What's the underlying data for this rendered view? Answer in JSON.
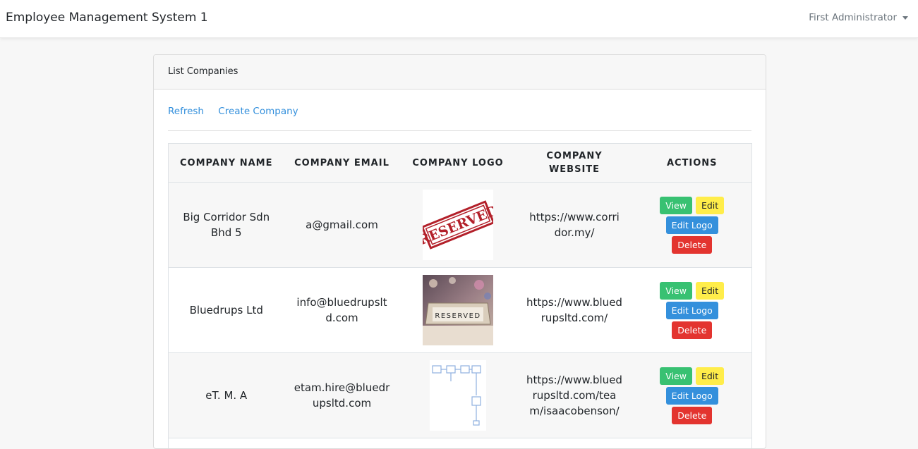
{
  "navbar": {
    "brand": "Employee Management System 1",
    "user": "First Administrator"
  },
  "card": {
    "title": "List Companies",
    "links": {
      "refresh": "Refresh",
      "create": "Create Company"
    }
  },
  "table": {
    "headers": {
      "name": "COMPANY NAME",
      "email": "COMPANY EMAIL",
      "logo": "COMPANY LOGO",
      "website": "COMPANY WEBSITE",
      "actions": "ACTIONS"
    },
    "rows": [
      {
        "name": "Big Corridor Sdn Bhd 5",
        "email": "a@gmail.com",
        "logo": "reserved-stamp-logo",
        "website": "https://www.corridor.my/"
      },
      {
        "name": "Bluedrups Ltd",
        "email": "info@bluedrupsltd.com",
        "logo": "reserved-sign-photo-logo",
        "website": "https://www.bluedrupsltd.com/"
      },
      {
        "name": "eT. M. A",
        "email": "etam.hire@bluedrupsltd.com",
        "logo": "flowchart-sketch-logo",
        "website": "https://www.bluedrupsltd.com/team/isaacobenson/"
      }
    ],
    "actions": {
      "view": "View",
      "edit": "Edit",
      "edit_logo": "Edit Logo",
      "delete": "Delete"
    }
  },
  "logo_text": {
    "reserved": "RESERVED"
  },
  "colors": {
    "view": "#38c172",
    "edit": "#ffed4a",
    "edit_logo": "#3490dc",
    "delete": "#e3342f",
    "link": "#3490dc"
  }
}
